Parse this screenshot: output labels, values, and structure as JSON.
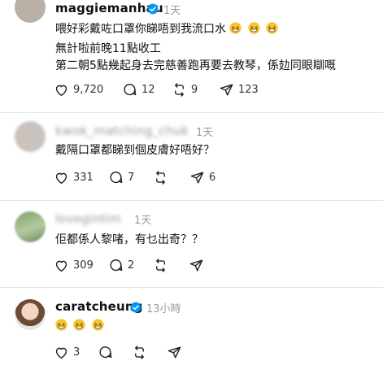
{
  "posts": [
    {
      "username": "maggiemanhau",
      "verified": true,
      "time": "1天",
      "lines": [
        "喂好彩戴咗口罩你睇唔到我流口水",
        "無計啦前晚11點收工",
        "第二朝5點幾起身去完慈善跑再要去教琴，係攰同眼瞓嘅"
      ],
      "emoji_count": 3,
      "likes": "9,720",
      "replies": "12",
      "reposts": "9",
      "shares": "123"
    },
    {
      "username": "kwok_matching_chuk",
      "verified": false,
      "time": "1天",
      "lines": [
        "戴隔口罩都睇到個皮膚好唔好？"
      ],
      "likes": "331",
      "replies": "7",
      "reposts": "",
      "shares": "6"
    },
    {
      "username": "lovegintim",
      "verified": false,
      "time": "1天",
      "lines": [
        "佢都係人黎啫，有乜出奇？？"
      ],
      "likes": "309",
      "replies": "2",
      "reposts": "",
      "shares": ""
    },
    {
      "username": "caratcheung",
      "verified": true,
      "time": "13小時",
      "lines": [],
      "emoji_count": 3,
      "likes": "3",
      "replies": "",
      "reposts": "",
      "shares": ""
    }
  ],
  "colors": {
    "verified": "#0095f6",
    "emoji": "#f7c32e"
  },
  "icons": [
    "heart-icon",
    "comment-icon",
    "repost-icon",
    "share-icon",
    "verified-badge-icon"
  ]
}
